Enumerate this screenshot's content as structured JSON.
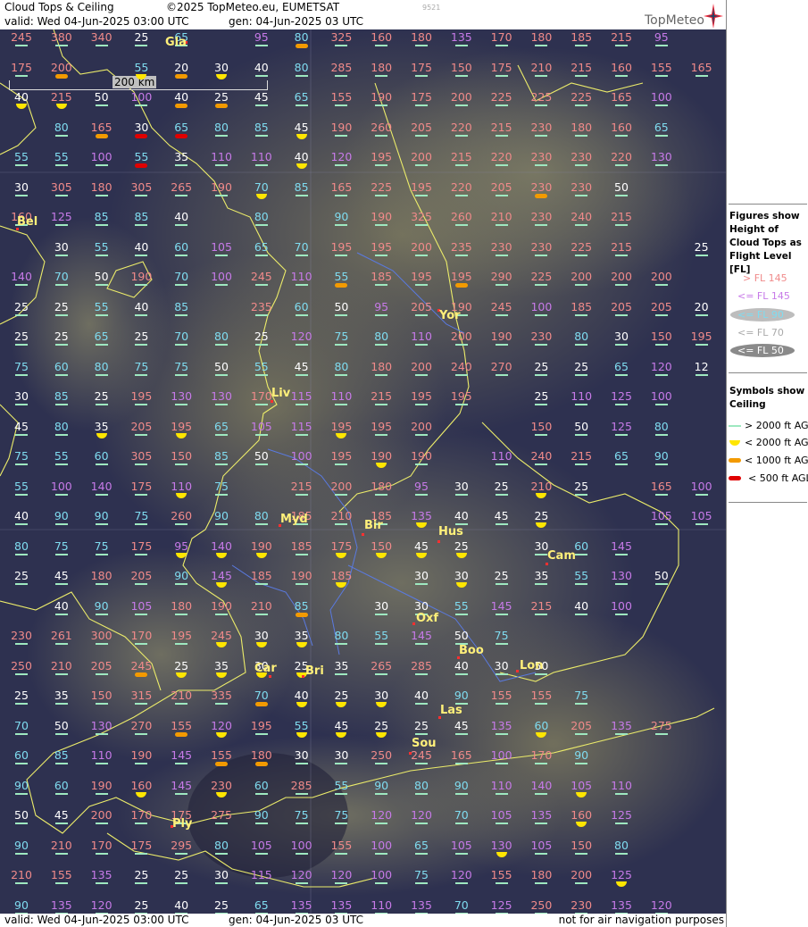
{
  "header": {
    "title": "Cloud Tops & Ceiling",
    "copyright": "©2025 TopMeteo.eu, EUMETSAT",
    "valid": "valid:  Wed  04-Jun-2025  03:00 UTC",
    "gen": "gen: 04-Jun-2025 03 UTC",
    "run_id": "9521",
    "logo": "TopMeteo"
  },
  "footer": {
    "valid": "valid:  Wed  04-Jun-2025  03:00 UTC",
    "gen": "gen: 04-Jun-2025 03 UTC",
    "disclaimer": "not for air navigation purposes"
  },
  "scale": {
    "label": "200 km"
  },
  "legend": {
    "heading_tops": "Figures show Height of Cloud Tops as Flight Level  [FL]",
    "tops": [
      {
        "label": "> FL 145",
        "color": "#f08a8a"
      },
      {
        "label": "<= FL 145",
        "color": "#c77ae8"
      },
      {
        "label": "<= FL 90",
        "color": "#7fdcf0"
      },
      {
        "label": "<= FL 70",
        "color": "#aaaaaa"
      },
      {
        "label": "<= FL 50",
        "color": "#ffffff"
      }
    ],
    "heading_ceiling": "Symbols show Ceiling",
    "ceiling": [
      {
        "label": "> 2000 ft AGL",
        "symbol": "line"
      },
      {
        "label": "< 2000 ft AGL",
        "symbol": "semicircle"
      },
      {
        "label": "< 1000 ft AGL",
        "symbol": "orange-bar"
      },
      {
        "label": "< 500 ft AGL",
        "symbol": "red-bar"
      }
    ]
  },
  "cities": [
    {
      "name": "Gla"
    },
    {
      "name": "Bel"
    },
    {
      "name": "Yor"
    },
    {
      "name": "Liv"
    },
    {
      "name": "Bir"
    },
    {
      "name": "Hus"
    },
    {
      "name": "Cam"
    },
    {
      "name": "Oxf"
    },
    {
      "name": "Boo"
    },
    {
      "name": "Car"
    },
    {
      "name": "Bri"
    },
    {
      "name": "Lon"
    },
    {
      "name": "Las"
    },
    {
      "name": "Sou"
    },
    {
      "name": "Ply"
    },
    {
      "name": "Myd"
    }
  ],
  "map_rows": [
    {
      "values": "245 380 340 25 65 . 95 80 325 160 180 135 170 180 185 215 95 .",
      "symbols": "l l l l l . l o l l l l l l l l l ."
    },
    {
      "values": "175 200 . 55 20 30 40 80 285 180 175 150 175 210 215 160 155 165",
      "symbols": "l o . s o s l l l l l l l l l l l l"
    },
    {
      "values": "40 215 50 100 40 25 45 65 155 190 175 200 225 225 225 165 100 .",
      "symbols": "s s l l o o l l l l l l l l l l l ."
    },
    {
      "values": ". 80 165 30 65 80 85 45 190 260 205 220 215 230 180 160 65 .",
      "symbols": ". l o r r l l s l l l l l l l l l ."
    },
    {
      "values": "55 55 100 55 35 110 110 40 120 195 200 215 220 230 230 220 130 .",
      "symbols": "l l l r l l l s l l l l l l l l l ."
    },
    {
      "values": "30 305 180 305 265 190 70 85 165 225 195 220 205 230 230 50 . .",
      "symbols": "l l l l l l s l l l l l l o l l . ."
    },
    {
      "values": "160 125 85 85 40 . 80 . 90 190 325 260 210 230 240 215 . .",
      "symbols": "l l l l l . l . l l l l l l l l . ."
    },
    {
      "values": ". 30 55 40 60 105 65 70 195 195 200 235 230 230 225 215 . 25",
      "symbols": ". l l l l l l l l l l l l l l l . l"
    },
    {
      "values": "140 70 50 190 70 100 245 110 55 185 195 195 290 225 200 200 200 .",
      "symbols": "l l l l l l l l o l l o l l l l l ."
    },
    {
      "values": "25 25 55 40 85 . 235 60 50 95 205 190 245 100 185 205 205 20",
      "symbols": "l l l l l . l l l l l l l l l l l l"
    },
    {
      "values": "25 25 65 25 70 80 25 120 75 80 110 200 190 230 80 30 150 195",
      "symbols": "l l l l l l l l l l l l l l l l l l"
    },
    {
      "values": "75 60 80 75 75 50 55 45 80 180 200 240 270 25 25 65 120 12",
      "symbols": "l l l l l l l l l l l l l l l l l l"
    },
    {
      "values": "30 85 25 195 130 130 170 115 110 215 195 195 . 25 110 125 100 .",
      "symbols": "l l l l l l l l l l l l . l l l l ."
    },
    {
      "values": "45 80 35 205 195 65 105 115 195 195 200 . . 150 50 125 80 .",
      "symbols": "l l s l s l l l s l l . . l l l l ."
    },
    {
      "values": "75 55 60 305 150 85 50 100 195 190 190 . 110 240 215 65 90 .",
      "symbols": "l l l l l l l l l s l . l l l l l ."
    },
    {
      "values": "55 100 140 175 110 75 . 215 200 180 95 30 25 210 25 . 165 100",
      "symbols": "l l l l s l . l l l l l l s l . l l"
    },
    {
      "values": "40 90 90 75 260 90 80 185 210 185 135 40 45 25 . . 105 105",
      "symbols": "l l l l l l l l l l s l l s . . l l"
    },
    {
      "values": "80 75 75 175 95 140 190 185 175 150 45 25 . 30 60 145 . .",
      "symbols": "l l l l s s s l s s s s . l l l . ."
    },
    {
      "values": "25 45 180 205 90 145 185 190 185 . 30 30 25 35 55 130 50 .",
      "symbols": "l l l l l s l l s . l s l l l l l ."
    },
    {
      "values": ". 40 90 105 180 190 210 85 . 30 30 55 145 215 40 100 . .",
      "symbols": ". l l l l l l o . l l l l l l l . ."
    },
    {
      "values": "230 261 300 170 195 245 30 35 80 55 145 50 75 . . . . .",
      "symbols": "l l l l l s s s l l l l l . . . . ."
    },
    {
      "values": "250 210 205 245 25 35 30 25 35 265 285 40 30 50 . . . .",
      "symbols": "l l l o s s s s l l l l l l . . . ."
    },
    {
      "values": "25 35 150 315 210 335 70 40 25 30 40 90 155 155 75 . . .",
      "symbols": "l l l l l l o s s s l l l l l . . ."
    },
    {
      "values": "70 50 130 270 155 120 195 55 45 25 25 45 135 60 205 135 275 .",
      "symbols": "l l l l o s l s s s l l l s l l l ."
    },
    {
      "values": "60 85 110 190 145 155 180 30 30 250 245 165 100 170 90 . . .",
      "symbols": "l l l l l o o l l l l l l l l . . ."
    },
    {
      "values": "90 60 190 160 145 230 60 285 55 90 80 90 110 140 105 110 . .",
      "symbols": "l l l s l s l l l l l l l l s l . ."
    },
    {
      "values": "50 45 200 170 175 275 90 75 75 120 120 70 105 135 160 125 . .",
      "symbols": "l l l l l l l l l l l l l l s l . ."
    },
    {
      "values": "90 210 170 175 295 80 105 100 155 100 65 105 130 105 150 80 . .",
      "symbols": "l l l l l l l l l l l l s l l l . ."
    },
    {
      "values": "210 155 135 25 25 30 115 120 120 100 75 120 155 180 200 125 . .",
      "symbols": "l l l l l l l l l l l l l l l s . ."
    },
    {
      "values": "90 135 120 25 40 25 65 135 135 110 135 70 125 250 230 135 120 .",
      "symbols": "l l l l l l l l l l l l l l l l l ."
    }
  ]
}
